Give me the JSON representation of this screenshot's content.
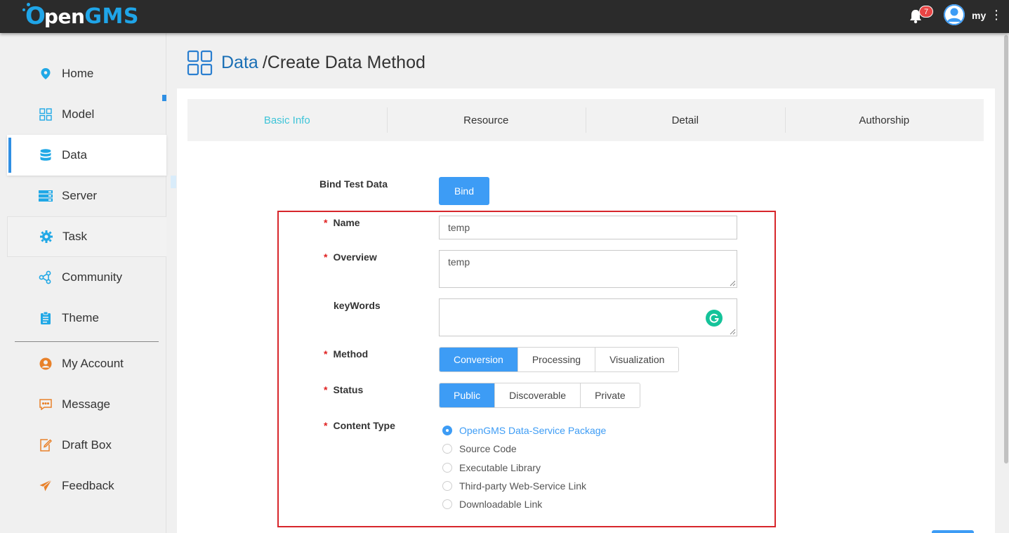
{
  "app": {
    "logo_text": "OpenGMS",
    "notification_count": "7",
    "username": "my"
  },
  "sidebar": {
    "items": [
      {
        "label": "Home",
        "icon": "location-pin-icon"
      },
      {
        "label": "Model",
        "icon": "grid-icon"
      },
      {
        "label": "Data",
        "icon": "database-icon"
      },
      {
        "label": "Server",
        "icon": "server-icon"
      },
      {
        "label": "Task",
        "icon": "gear-icon"
      },
      {
        "label": "Community",
        "icon": "share-nodes-icon"
      },
      {
        "label": "Theme",
        "icon": "clipboard-icon"
      },
      {
        "label": "My Account",
        "icon": "user-circle-icon"
      },
      {
        "label": "Message",
        "icon": "chat-icon"
      },
      {
        "label": "Draft Box",
        "icon": "edit-doc-icon"
      },
      {
        "label": "Feedback",
        "icon": "paper-plane-icon"
      }
    ],
    "active": "Data"
  },
  "breadcrumb": {
    "section": "Data",
    "page": "/Create Data Method"
  },
  "steps": [
    "Basic Info",
    "Resource",
    "Detail",
    "Authorship"
  ],
  "form": {
    "bind_test_data": {
      "label": "Bind Test Data",
      "button": "Bind"
    },
    "name": {
      "label": "Name",
      "value": "temp",
      "required": "*"
    },
    "overview": {
      "label": "Overview",
      "value": "temp",
      "required": "*"
    },
    "keywords": {
      "label": "keyWords",
      "value": ""
    },
    "method": {
      "label": "Method",
      "required": "*",
      "options": [
        "Conversion",
        "Processing",
        "Visualization"
      ],
      "selected": "Conversion"
    },
    "status": {
      "label": "Status",
      "required": "*",
      "options": [
        "Public",
        "Discoverable",
        "Private"
      ],
      "selected": "Public"
    },
    "content_type": {
      "label": "Content Type",
      "required": "*",
      "options": [
        "OpenGMS Data-Service Package",
        "Source Code",
        "Executable Library",
        "Third-party Web-Service Link",
        "Downloadable Link"
      ],
      "selected": "OpenGMS Data-Service Package"
    }
  },
  "colors": {
    "accent": "#3d9cf5",
    "brand": "#1fa5e8",
    "highlight_border": "#d7262b",
    "active_step": "#3ec4d8"
  }
}
